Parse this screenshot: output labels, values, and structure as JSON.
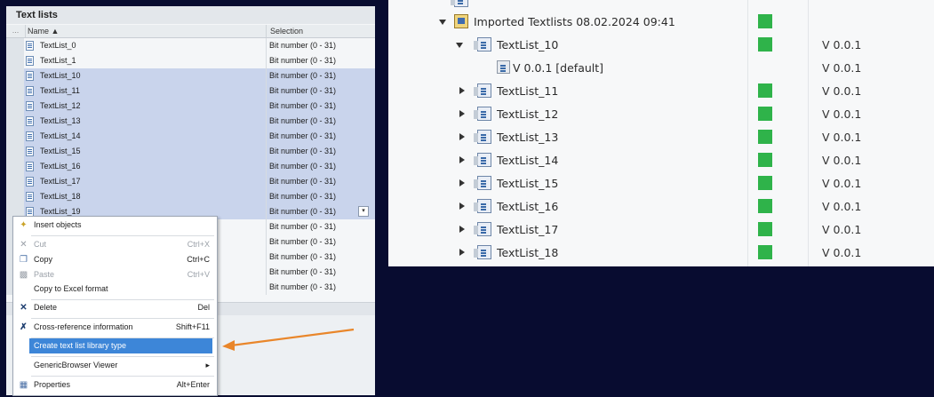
{
  "left": {
    "title": "Text lists",
    "header": {
      "col_name": "Name ▲",
      "col_selection": "Selection",
      "col_gutter": "..."
    },
    "rows": [
      {
        "name": "TextList_0",
        "selection": "Bit number (0 - 31)",
        "selected": false
      },
      {
        "name": "TextList_1",
        "selection": "Bit number (0 - 31)",
        "selected": false
      },
      {
        "name": "TextList_10",
        "selection": "Bit number (0 - 31)",
        "selected": true
      },
      {
        "name": "TextList_11",
        "selection": "Bit number (0 - 31)",
        "selected": true
      },
      {
        "name": "TextList_12",
        "selection": "Bit number (0 - 31)",
        "selected": true
      },
      {
        "name": "TextList_13",
        "selection": "Bit number (0 - 31)",
        "selected": true
      },
      {
        "name": "TextList_14",
        "selection": "Bit number (0 - 31)",
        "selected": true
      },
      {
        "name": "TextList_15",
        "selection": "Bit number (0 - 31)",
        "selected": true
      },
      {
        "name": "TextList_16",
        "selection": "Bit number (0 - 31)",
        "selected": true
      },
      {
        "name": "TextList_17",
        "selection": "Bit number (0 - 31)",
        "selected": true
      },
      {
        "name": "TextList_18",
        "selection": "Bit number (0 - 31)",
        "selected": true
      },
      {
        "name": "TextList_19",
        "selection": "Bit number (0 - 31)",
        "selected": true
      },
      {
        "name": "",
        "selection": "Bit number (0 - 31)",
        "selected": false
      },
      {
        "name": "",
        "selection": "Bit number (0 - 31)",
        "selected": false
      },
      {
        "name": "",
        "selection": "Bit number (0 - 31)",
        "selected": false
      },
      {
        "name": "",
        "selection": "Bit number (0 - 31)",
        "selected": false
      },
      {
        "name": "",
        "selection": "Bit number (0 - 31)",
        "selected": false
      }
    ],
    "dropdown_glyph": "▾"
  },
  "context_menu": {
    "insert": "Insert objects",
    "cut": "Cut",
    "cut_sc": "Ctrl+X",
    "copy": "Copy",
    "copy_sc": "Ctrl+C",
    "paste": "Paste",
    "paste_sc": "Ctrl+V",
    "copy_excel": "Copy to Excel format",
    "delete": "Delete",
    "delete_sc": "Del",
    "xref": "Cross-reference information",
    "xref_sc": "Shift+F11",
    "create_type": "Create text list library type",
    "generic": "GenericBrowser Viewer",
    "generic_arrow": "▸",
    "properties": "Properties",
    "properties_sc": "Alt+Enter"
  },
  "arrow_color": "#e9862a",
  "right": {
    "folder": "Imported Textlists 08.02.2024 09:41",
    "expanded": {
      "name": "TextList_10",
      "version": "V 0.0.1"
    },
    "default_version": {
      "name": "V 0.0.1 [default]",
      "version": "V 0.0.1"
    },
    "items": [
      {
        "name": "TextList_11",
        "version": "V 0.0.1"
      },
      {
        "name": "TextList_12",
        "version": "V 0.0.1"
      },
      {
        "name": "TextList_13",
        "version": "V 0.0.1"
      },
      {
        "name": "TextList_14",
        "version": "V 0.0.1"
      },
      {
        "name": "TextList_15",
        "version": "V 0.0.1"
      },
      {
        "name": "TextList_16",
        "version": "V 0.0.1"
      },
      {
        "name": "TextList_17",
        "version": "V 0.0.1"
      },
      {
        "name": "TextList_18",
        "version": "V 0.0.1"
      }
    ],
    "status_color": "#2fb34a"
  }
}
